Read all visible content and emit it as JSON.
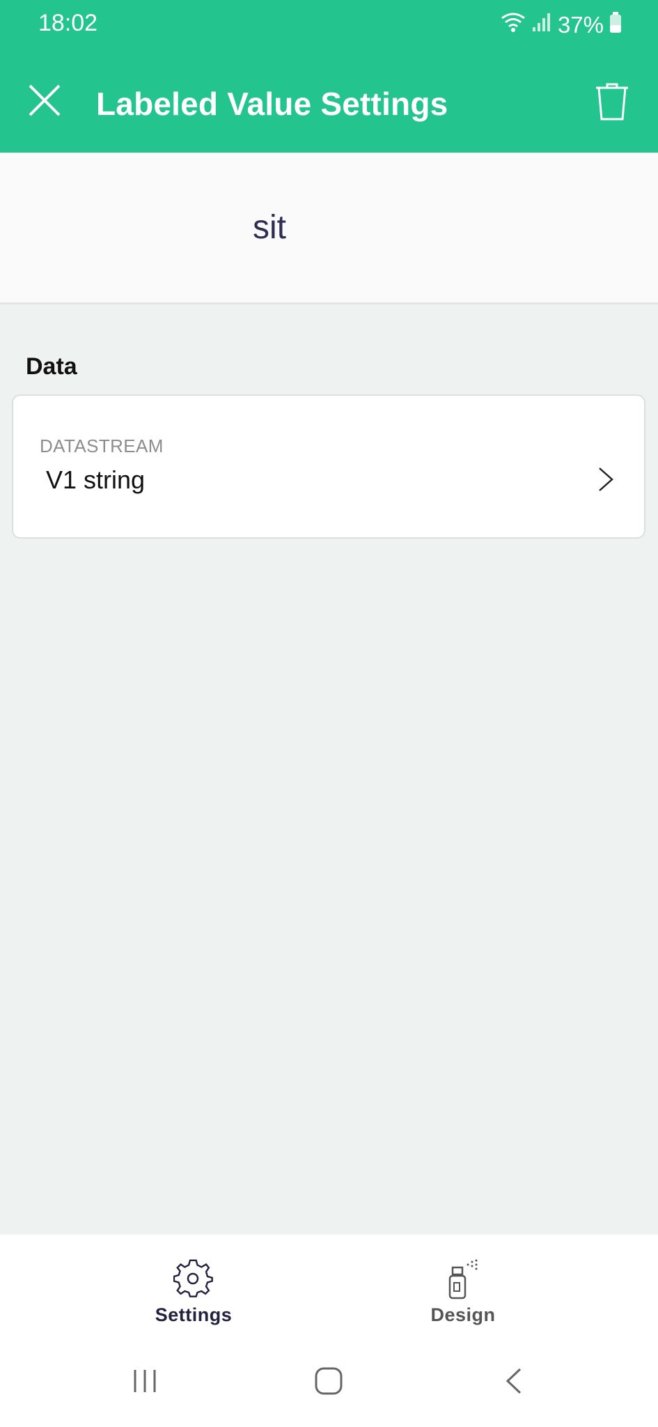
{
  "status_bar": {
    "time": "18:02",
    "battery": "37%",
    "icons": [
      "wifi-icon",
      "signal-icon",
      "battery-icon"
    ]
  },
  "header": {
    "title": "Labeled Value Settings",
    "close_icon": "close-icon",
    "delete_icon": "trash-icon",
    "background": "#23c48e"
  },
  "preview": {
    "value": "sit"
  },
  "data_section": {
    "label": "Data",
    "datastream": {
      "caption": "DATASTREAM",
      "value": "V1 string"
    }
  },
  "bottom_nav": {
    "items": [
      {
        "label": "Settings",
        "icon": "gear-icon",
        "active": true
      },
      {
        "label": "Design",
        "icon": "spray-can-icon",
        "active": false
      }
    ]
  },
  "system_nav": {
    "icons": [
      "recent-apps-icon",
      "home-icon",
      "back-icon"
    ]
  }
}
